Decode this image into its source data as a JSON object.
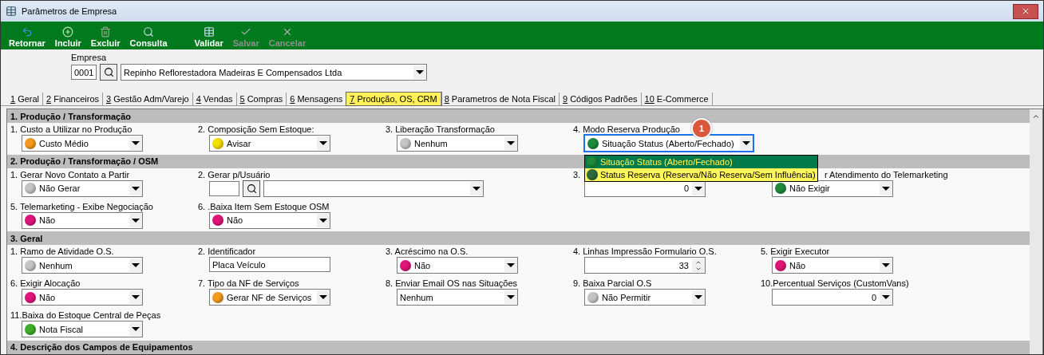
{
  "window": {
    "title": "Parâmetros de Empresa"
  },
  "toolbar": [
    {
      "label": "Retornar",
      "disabled": false
    },
    {
      "label": "Incluir",
      "disabled": false
    },
    {
      "label": "Excluir",
      "disabled": false
    },
    {
      "label": "Consulta",
      "disabled": false
    },
    {
      "label": "Validar",
      "disabled": false
    },
    {
      "label": "Salvar",
      "disabled": true
    },
    {
      "label": "Cancelar",
      "disabled": true
    }
  ],
  "empresa": {
    "label": "Empresa",
    "code": "0001",
    "company": "Repinho Reflorestadora Madeiras E Compensados Ltda"
  },
  "tabs": [
    {
      "number": "1",
      "label": "Geral",
      "selected": false
    },
    {
      "number": "2",
      "label": "Financeiros",
      "selected": false
    },
    {
      "number": "3",
      "label": "Gestão Adm/Varejo",
      "selected": false
    },
    {
      "number": "4",
      "label": "Vendas",
      "selected": false
    },
    {
      "number": "5",
      "label": "Compras",
      "selected": false
    },
    {
      "number": "6",
      "label": "Mensagens",
      "selected": false
    },
    {
      "number": "7",
      "label": "Produção, OS, CRM",
      "selected": true
    },
    {
      "number": "8",
      "label": "Parametros de Nota Fiscal",
      "selected": false
    },
    {
      "number": "9",
      "label": "Códigos Padrões",
      "selected": false
    },
    {
      "number": "10",
      "label": "E-Commerce",
      "selected": false
    }
  ],
  "sections": [
    {
      "title": "1. Produção / Transformação",
      "rows": [
        [
          {
            "kind": "combo",
            "label": "1. Custo a Utilizar no Produção",
            "value": "Custo Médio",
            "color": "#f39a1e"
          },
          {
            "kind": "combo",
            "label": "2. Composição Sem Estoque:",
            "value": "Avisar",
            "color": "#f2e000"
          },
          {
            "kind": "combo",
            "label": "3. Liberação Transformação",
            "value": "Nenhum",
            "color": "#c4c4c4"
          },
          {
            "kind": "combo",
            "label": "4. Modo Reserva Produção",
            "value": "Situação Status (Aberto/Fechado)",
            "color": "#1e8a3a",
            "badge": "1",
            "open": true,
            "options": [
              {
                "label": "Situação Status (Aberto/Fechado)",
                "color": "#1e8a3a",
                "selected": true
              },
              {
                "label": "Status Reserva (Reserva/Não Reserva/Sem Influência)",
                "color": "#2f6b3a",
                "selected": false
              }
            ]
          }
        ]
      ]
    },
    {
      "title": "2. Produção / Transformação / OSM",
      "rows": [
        [
          {
            "kind": "combo",
            "label": "1. Gerar Novo Contato a Partir",
            "value": "Não Gerar",
            "color": "#c4c4c4"
          },
          {
            "kind": "lookup",
            "label": "2. Gerar p/Usuário"
          },
          {
            "kind": "number",
            "label": "3.",
            "value": "0"
          },
          {
            "kind": "combo",
            "label": "r Atendimento do Telemarketing",
            "value": "Não Exigir",
            "color": "#1e8a3a",
            "hidden_start": true
          }
        ],
        [
          {
            "kind": "combo",
            "label": "5. Telemarketing - Exibe Negociação",
            "value": "Não",
            "color": "#e0157a"
          },
          {
            "kind": "combo",
            "label": "6. .Baixa Item Sem Estoque OSM",
            "value": "Não",
            "color": "#e0157a"
          }
        ]
      ]
    },
    {
      "title": "3. Geral",
      "rows": [
        [
          {
            "kind": "combo",
            "label": "1. Ramo de Atividade O.S.",
            "value": "Nenhum",
            "color": "#c4c4c4"
          },
          {
            "kind": "text",
            "label": "2. Identificador",
            "value": "Placa Veículo"
          },
          {
            "kind": "combo",
            "label": "3. Acréscimo na O.S.",
            "value": "Não",
            "color": "#e0157a"
          },
          {
            "kind": "spin",
            "label": "4. Linhas Impressão Formulario O.S.",
            "value": "33"
          },
          {
            "kind": "combo",
            "label": "5. Exigir Executor",
            "value": "Não",
            "color": "#e0157a"
          }
        ],
        [
          {
            "kind": "combo",
            "label": "6. Exigir Alocação",
            "value": "Não",
            "color": "#e0157a"
          },
          {
            "kind": "combo",
            "label": "7. Tipo da NF de Serviços",
            "value": "Gerar NF de Serviços",
            "color": "#f39a1e"
          },
          {
            "kind": "combo",
            "label": "8. Enviar Email OS nas Situações",
            "value": "Nenhum"
          },
          {
            "kind": "combo",
            "label": "9. Baixa Parcial O.S",
            "value": "Não Permitir",
            "color": "#c4c4c4"
          },
          {
            "kind": "number",
            "label": "10.Percentual Serviços (CustomVans)",
            "value": "0"
          }
        ],
        [
          {
            "kind": "combo",
            "label": "11.Baixa do Estoque Central de Peças",
            "value": "Nota Fiscal",
            "color": "#3fae2a"
          }
        ]
      ]
    },
    {
      "title": "4. Descrição dos Campos de Equipamentos"
    }
  ]
}
